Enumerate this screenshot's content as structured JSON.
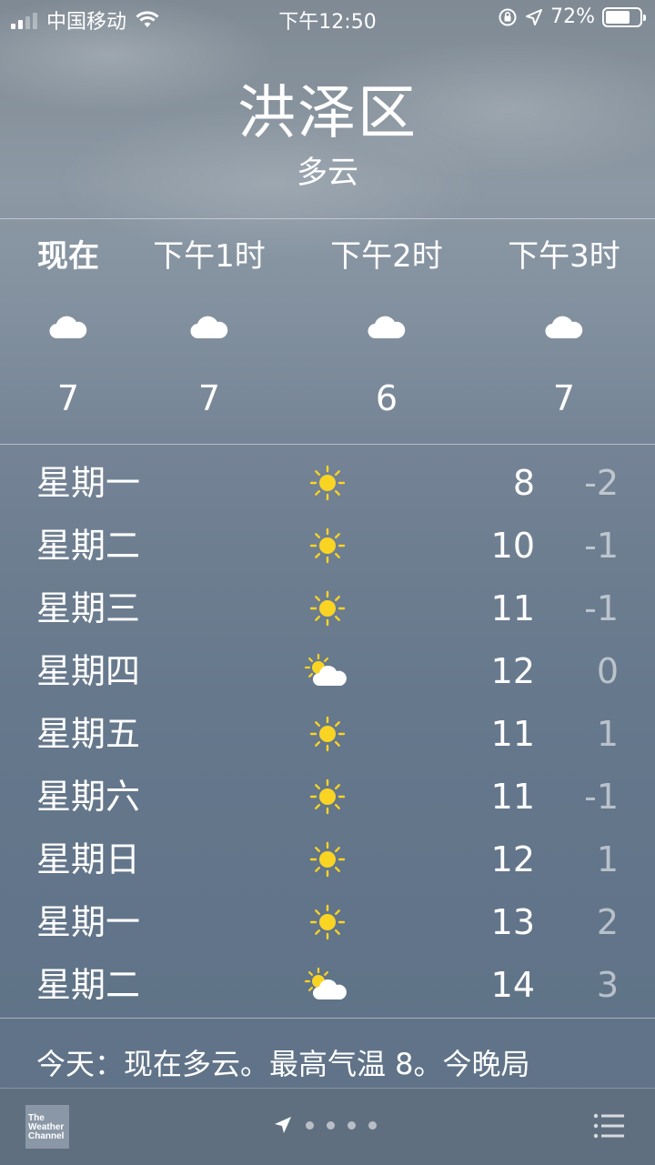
{
  "status_bar": {
    "carrier": "中国移动",
    "time": "下午12:50",
    "battery": "72%",
    "battery_level": 0.72
  },
  "location": {
    "city": "洪泽区",
    "condition": "多云"
  },
  "hourly": [
    {
      "label": "现在",
      "icon": "cloud-icon",
      "temp": "7"
    },
    {
      "label": "下午1时",
      "icon": "cloud-icon",
      "temp": "7"
    },
    {
      "label": "下午2时",
      "icon": "cloud-icon",
      "temp": "6"
    },
    {
      "label": "下午3时",
      "icon": "cloud-icon",
      "temp": "7"
    }
  ],
  "daily": [
    {
      "day": "星期一",
      "icon": "sun-icon",
      "high": "8",
      "low": "-2"
    },
    {
      "day": "星期二",
      "icon": "sun-icon",
      "high": "10",
      "low": "-1"
    },
    {
      "day": "星期三",
      "icon": "sun-icon",
      "high": "11",
      "low": "-1"
    },
    {
      "day": "星期四",
      "icon": "partly-cloudy-icon",
      "high": "12",
      "low": "0"
    },
    {
      "day": "星期五",
      "icon": "sun-icon",
      "high": "11",
      "low": "1"
    },
    {
      "day": "星期六",
      "icon": "sun-icon",
      "high": "11",
      "low": "-1"
    },
    {
      "day": "星期日",
      "icon": "sun-icon",
      "high": "12",
      "low": "1"
    },
    {
      "day": "星期一",
      "icon": "sun-icon",
      "high": "13",
      "low": "2"
    },
    {
      "day": "星期二",
      "icon": "partly-cloudy-icon",
      "high": "14",
      "low": "3"
    }
  ],
  "summary": "今天：现在多云。最高气温 8。今晚局",
  "bottom_bar": {
    "logo_text": "The Weather Channel",
    "page_dots": 4,
    "current_page_icon": "location-arrow-icon",
    "list_icon": "list-icon"
  },
  "colors": {
    "sun": "#f9d423",
    "low_temp": "rgba(255,255,255,0.55)"
  }
}
